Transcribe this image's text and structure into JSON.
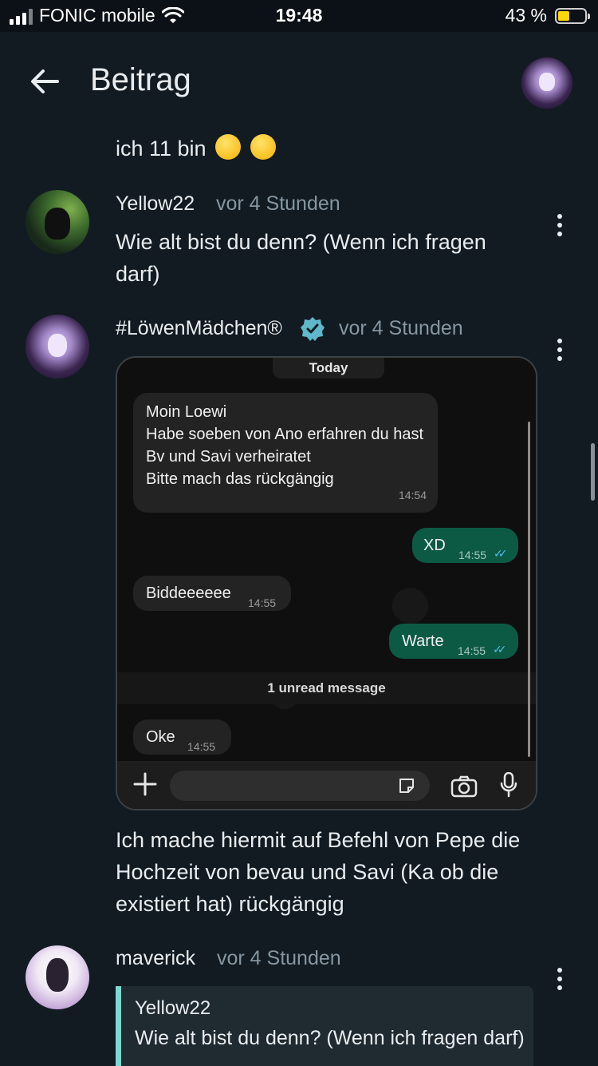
{
  "status_bar": {
    "carrier": "FONIC mobile",
    "time": "19:48",
    "battery_percent_text": "43 %",
    "battery_level": 0.43
  },
  "header": {
    "title": "Beitrag"
  },
  "posts": [
    {
      "text": "ich 11 bin"
    },
    {
      "author": "Yellow22",
      "time": "vor 4 Stunden",
      "text": "Wie alt bist du denn? (Wenn ich fragen darf)"
    },
    {
      "author": "#LöwenMädchen®",
      "time": "vor 4 Stunden",
      "verified": true,
      "screenshot": {
        "date_chip": "Today",
        "messages": [
          {
            "direction": "in",
            "text": "Moin Loewi\nHabe soeben von Ano erfahren du hast Bv und Savi verheiratet\nBitte mach das rückgängig",
            "time": "14:54"
          },
          {
            "direction": "out",
            "text": "XD",
            "time": "14:55"
          },
          {
            "direction": "in",
            "text": "Biddeeeeee",
            "time": "14:55"
          },
          {
            "direction": "out",
            "text": "Warte",
            "time": "14:55"
          },
          {
            "direction": "in",
            "text": "Oke",
            "time": "14:55"
          }
        ],
        "unread_banner": "1 unread message"
      },
      "text": "Ich mache hiermit auf Befehl von Pepe die Hochzeit von bevau und Savi (Ka ob die existiert hat) rückgängig"
    },
    {
      "author": "maverick",
      "time": "vor 4 Stunden",
      "quote": {
        "author": "Yellow22",
        "text": "Wie alt bist du denn? (Wenn ich fragen darf)"
      }
    }
  ],
  "colors": {
    "background": "#121b22",
    "secondary_text": "#8696a0",
    "verified": "#5fb8c9",
    "outgoing_bubble": "#0c5a44",
    "quote_bar": "#7dd8d0"
  }
}
